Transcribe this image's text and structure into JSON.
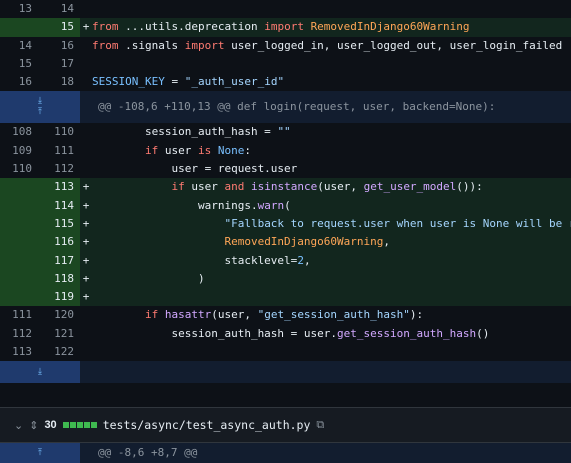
{
  "diff": {
    "rows": [
      {
        "type": "ctx",
        "old": "13",
        "new": "14",
        "sign": " ",
        "tokens": []
      },
      {
        "type": "add",
        "old": "",
        "new": "15",
        "sign": "+",
        "tokens": [
          {
            "c": "kw",
            "t": "from "
          },
          {
            "c": "plain",
            "t": "...utils.deprecation "
          },
          {
            "c": "kw",
            "t": "import "
          },
          {
            "c": "cls",
            "t": "RemovedInDjango60Warning"
          }
        ]
      },
      {
        "type": "ctx",
        "old": "14",
        "new": "16",
        "sign": " ",
        "tokens": [
          {
            "c": "kw",
            "t": "from "
          },
          {
            "c": "plain",
            "t": ".signals "
          },
          {
            "c": "kw",
            "t": "import "
          },
          {
            "c": "plain",
            "t": "user_logged_in, user_logged_out, user_login_failed"
          }
        ]
      },
      {
        "type": "ctx",
        "old": "15",
        "new": "17",
        "sign": " ",
        "tokens": []
      },
      {
        "type": "ctx",
        "old": "16",
        "new": "18",
        "sign": " ",
        "tokens": [
          {
            "c": "const",
            "t": "SESSION_KEY"
          },
          {
            "c": "plain",
            "t": " = "
          },
          {
            "c": "str",
            "t": "\"_auth_user_id\""
          }
        ]
      }
    ],
    "hunk1": "@@ -108,6 +110,13 @@ def login(request, user, backend=None):",
    "rows2": [
      {
        "type": "ctx",
        "old": "108",
        "new": "110",
        "sign": " ",
        "tokens": [
          {
            "c": "plain",
            "t": "        session_auth_hash = "
          },
          {
            "c": "str",
            "t": "\"\""
          }
        ]
      },
      {
        "type": "ctx",
        "old": "109",
        "new": "111",
        "sign": " ",
        "tokens": [
          {
            "c": "plain",
            "t": "        "
          },
          {
            "c": "kw",
            "t": "if "
          },
          {
            "c": "plain",
            "t": "user "
          },
          {
            "c": "kw",
            "t": "is "
          },
          {
            "c": "const",
            "t": "None"
          },
          {
            "c": "plain",
            "t": ":"
          }
        ]
      },
      {
        "type": "ctx",
        "old": "110",
        "new": "112",
        "sign": " ",
        "tokens": [
          {
            "c": "plain",
            "t": "            user = request.user"
          }
        ]
      },
      {
        "type": "add",
        "old": "",
        "new": "113",
        "sign": "+",
        "tokens": [
          {
            "c": "plain",
            "t": "            "
          },
          {
            "c": "kw",
            "t": "if "
          },
          {
            "c": "plain",
            "t": "user "
          },
          {
            "c": "kw",
            "t": "and "
          },
          {
            "c": "fn",
            "t": "isinstance"
          },
          {
            "c": "plain",
            "t": "(user, "
          },
          {
            "c": "fn",
            "t": "get_user_model"
          },
          {
            "c": "plain",
            "t": "()):"
          }
        ]
      },
      {
        "type": "add",
        "old": "",
        "new": "114",
        "sign": "+",
        "tokens": [
          {
            "c": "plain",
            "t": "                warnings."
          },
          {
            "c": "fn",
            "t": "warn"
          },
          {
            "c": "plain",
            "t": "("
          }
        ]
      },
      {
        "type": "add",
        "old": "",
        "new": "115",
        "sign": "+",
        "tokens": [
          {
            "c": "plain",
            "t": "                    "
          },
          {
            "c": "str",
            "t": "\"Fallback to request.user when user is None will be removed.\""
          },
          {
            "c": "plain",
            "t": ","
          }
        ]
      },
      {
        "type": "add",
        "old": "",
        "new": "116",
        "sign": "+",
        "tokens": [
          {
            "c": "plain",
            "t": "                    "
          },
          {
            "c": "cls",
            "t": "RemovedInDjango60Warning"
          },
          {
            "c": "plain",
            "t": ","
          }
        ]
      },
      {
        "type": "add",
        "old": "",
        "new": "117",
        "sign": "+",
        "tokens": [
          {
            "c": "plain",
            "t": "                    stacklevel="
          },
          {
            "c": "num",
            "t": "2"
          },
          {
            "c": "plain",
            "t": ","
          }
        ]
      },
      {
        "type": "add",
        "old": "",
        "new": "118",
        "sign": "+",
        "tokens": [
          {
            "c": "plain",
            "t": "                )"
          }
        ]
      },
      {
        "type": "add",
        "old": "",
        "new": "119",
        "sign": "+",
        "tokens": []
      },
      {
        "type": "ctx",
        "old": "111",
        "new": "120",
        "sign": " ",
        "tokens": [
          {
            "c": "plain",
            "t": "        "
          },
          {
            "c": "kw",
            "t": "if "
          },
          {
            "c": "fn",
            "t": "hasattr"
          },
          {
            "c": "plain",
            "t": "(user, "
          },
          {
            "c": "str",
            "t": "\"get_session_auth_hash\""
          },
          {
            "c": "plain",
            "t": "):"
          }
        ]
      },
      {
        "type": "ctx",
        "old": "112",
        "new": "121",
        "sign": " ",
        "tokens": [
          {
            "c": "plain",
            "t": "            session_auth_hash = user."
          },
          {
            "c": "fn",
            "t": "get_session_auth_hash"
          },
          {
            "c": "plain",
            "t": "()"
          }
        ]
      },
      {
        "type": "ctx",
        "old": "113",
        "new": "122",
        "sign": " ",
        "tokens": []
      }
    ]
  },
  "file2": {
    "count": "30",
    "filename": "tests/async/test_async_auth.py",
    "bars": [
      true,
      true,
      true,
      true,
      true
    ],
    "hunk": "@@ -8,6 +8,7 @@"
  }
}
